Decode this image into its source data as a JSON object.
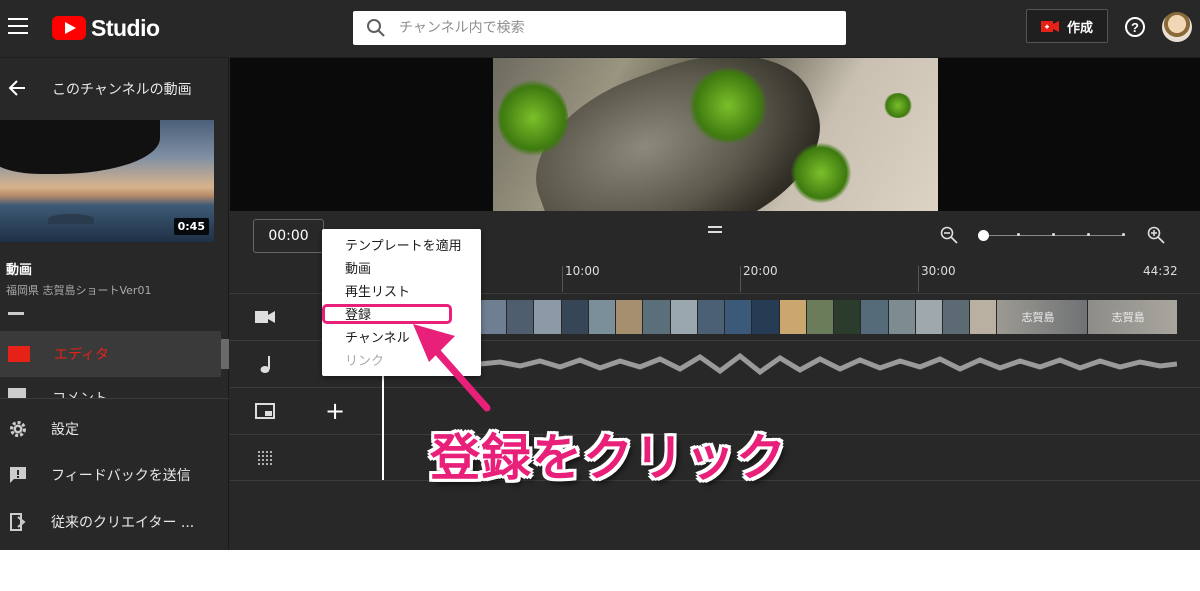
{
  "header": {
    "logo_text": "Studio",
    "search_placeholder": "チャンネル内で検索",
    "create_label": "作成",
    "help_label": "?"
  },
  "sidebar": {
    "back_label": "このチャンネルの動画",
    "video": {
      "duration": "0:45",
      "section_label": "動画",
      "title": "福岡県 志賀島ショートVer01"
    },
    "active_item": "エディタ",
    "partial_item": "コメント",
    "footer": [
      {
        "icon": "gear-icon",
        "label": "設定"
      },
      {
        "icon": "feedback-icon",
        "label": "フィードバックを送信"
      },
      {
        "icon": "classic-studio-icon",
        "label": "従来のクリエイター ..."
      }
    ]
  },
  "timeline": {
    "current_time": "00:00",
    "ruler_ticks": [
      "10:00",
      "20:00",
      "30:00",
      "44:32"
    ],
    "filmstrip_labels": [
      "志賀島",
      "志賀島"
    ],
    "zoom_level_fraction": 0
  },
  "context_menu": {
    "items": [
      {
        "label": "テンプレートを適用",
        "disabled": false
      },
      {
        "label": "動画",
        "disabled": false
      },
      {
        "label": "再生リスト",
        "disabled": false
      },
      {
        "label": "登録",
        "disabled": false,
        "highlighted": true
      },
      {
        "label": "チャンネル",
        "disabled": false
      },
      {
        "label": "リンク",
        "disabled": true
      }
    ]
  },
  "annotation": {
    "text": "登録をクリック",
    "color": "#e8207a"
  },
  "colors": {
    "brand_red": "#ff0000",
    "editor_red": "#e62117",
    "background": "#282828"
  }
}
